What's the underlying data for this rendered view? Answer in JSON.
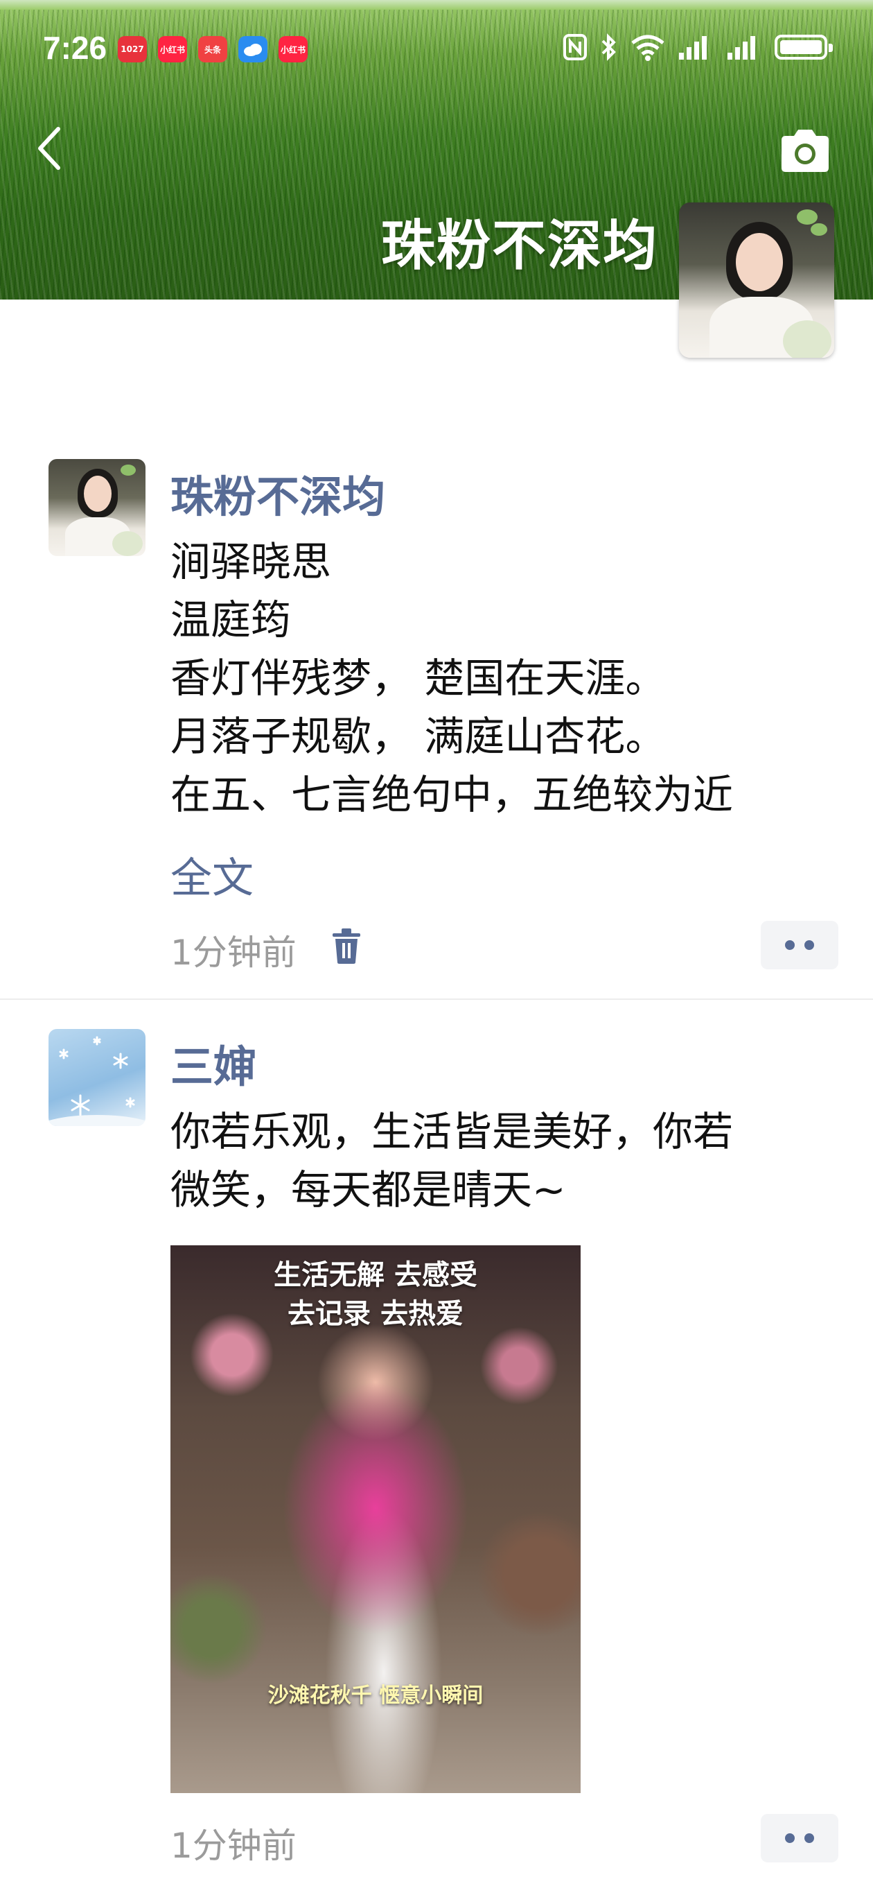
{
  "status_bar": {
    "time": "7:26",
    "app_badges": [
      {
        "label": "1027",
        "color": "#e8323c"
      },
      {
        "label": "小红书",
        "color": "#ff2442"
      },
      {
        "label": "头条",
        "color": "#f04142"
      },
      {
        "label": "",
        "color": "#2a8cf0"
      },
      {
        "label": "小红书",
        "color": "#ff2442"
      }
    ]
  },
  "header": {
    "profile_name": "珠粉不深均"
  },
  "posts": [
    {
      "author": "珠粉不深均",
      "lines": [
        "涧驿晓思",
        "温庭筠",
        "香灯伴残梦， 楚国在天涯。",
        "月落子规歇， 满庭山杏花。",
        "在五、七言绝句中，五绝较为近"
      ],
      "full_text_label": "全文",
      "time": "1分钟前"
    },
    {
      "author": "三婶",
      "lines": [
        "你若乐观，生活皆是美好，你若",
        "微笑，每天都是晴天~"
      ],
      "video": {
        "caption_top": "生活无解 去感受",
        "caption_mid": "去记录 去热爱",
        "caption_bottom": "沙滩花秋千 惬意小瞬间"
      },
      "time": "1分钟前"
    }
  ]
}
